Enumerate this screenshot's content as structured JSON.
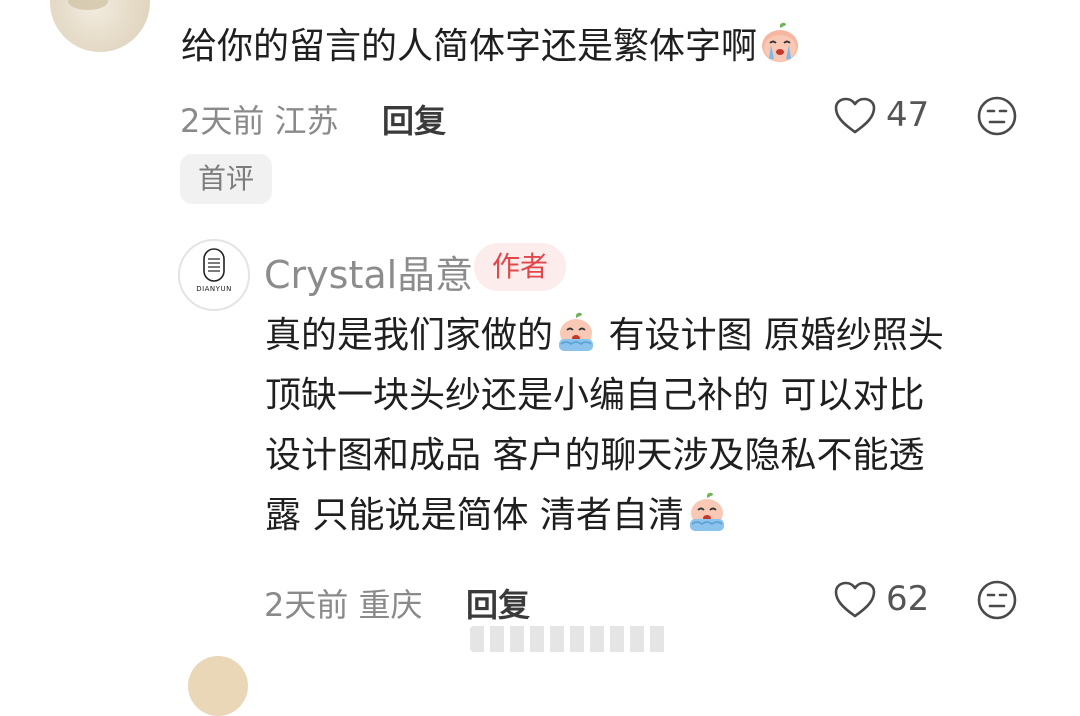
{
  "comment": {
    "text": "给你的留言的人简体字还是繁体字啊",
    "emoji": "crying-peach-emoji",
    "time": "2天前",
    "location": "江苏",
    "reply_label": "回复",
    "likes": "47",
    "badge": "首评"
  },
  "reply": {
    "username": "Crystal晶意",
    "author_badge": "作者",
    "avatar_logo": "DIANYUN",
    "lines": [
      "真的是我们家做的",
      "有设计图 原婚纱照头",
      "顶缺一块头纱还是小编自己补的 可以对比",
      "设计图和成品 客户的聊天涉及隐私不能透",
      "露 只能说是简体 清者自清"
    ],
    "emoji": "crying-peach-emoji",
    "time": "2天前",
    "location": "重庆",
    "reply_label": "回复",
    "likes": "62"
  },
  "colors": {
    "text": "#1f1f1f",
    "meta": "#8a8a8a",
    "author_badge_bg": "#fdecec",
    "author_badge_text": "#e0474b",
    "chip_bg": "#f1f1f1"
  }
}
